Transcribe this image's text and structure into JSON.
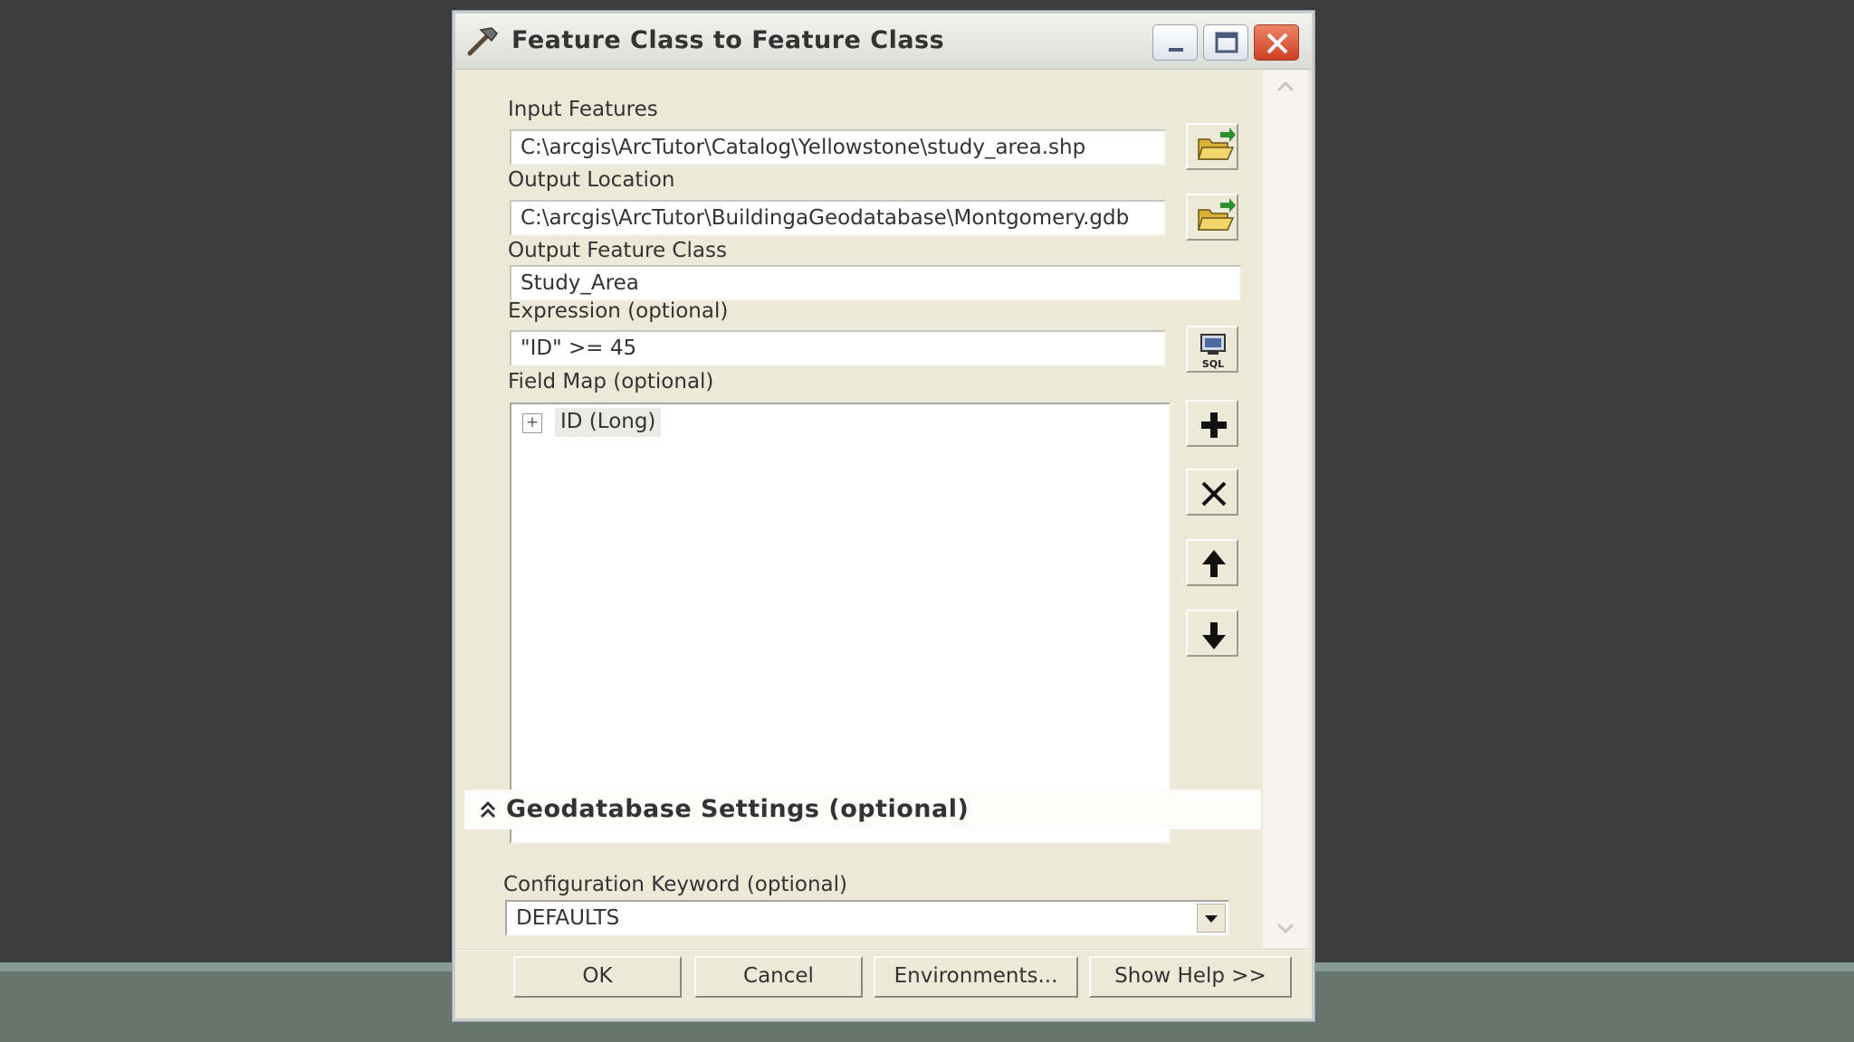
{
  "dialog": {
    "title": "Feature Class to Feature Class",
    "title_icon": "hammer-icon",
    "window_controls": [
      "minimize-icon",
      "maximize-icon",
      "close-icon"
    ]
  },
  "form": {
    "input_features": {
      "label": "Input Features",
      "value": "C:\\arcgis\\ArcTutor\\Catalog\\Yellowstone\\study_area.shp",
      "browse_icon": "open-folder-icon"
    },
    "output_location": {
      "label": "Output Location",
      "value": "C:\\arcgis\\ArcTutor\\BuildingaGeodatabase\\Montgomery.gdb",
      "browse_icon": "open-folder-icon"
    },
    "output_feature_class": {
      "label": "Output Feature Class",
      "value": "Study_Area"
    },
    "expression": {
      "label": "Expression (optional)",
      "value": "\"ID\" >= 45",
      "sql_icon": "sql-query-icon"
    },
    "field_map": {
      "label": "Field Map (optional)",
      "expander": "+",
      "fields": [
        "ID (Long)"
      ],
      "tools": [
        "add-icon",
        "delete-icon",
        "move-up-icon",
        "move-down-icon"
      ]
    }
  },
  "geodatabase_settings": {
    "title": "Geodatabase Settings (optional)",
    "config_keyword": {
      "label": "Configuration Keyword (optional)",
      "value": "DEFAULTS"
    }
  },
  "buttons": {
    "ok": "OK",
    "cancel": "Cancel",
    "environments": "Environments...",
    "show_help": "Show Help >>"
  },
  "colors": {
    "background": "#3c3c3c",
    "dialog_face": "#ece9d8",
    "close_button": "#cf3f24",
    "taskbar_band": "#66766f"
  }
}
